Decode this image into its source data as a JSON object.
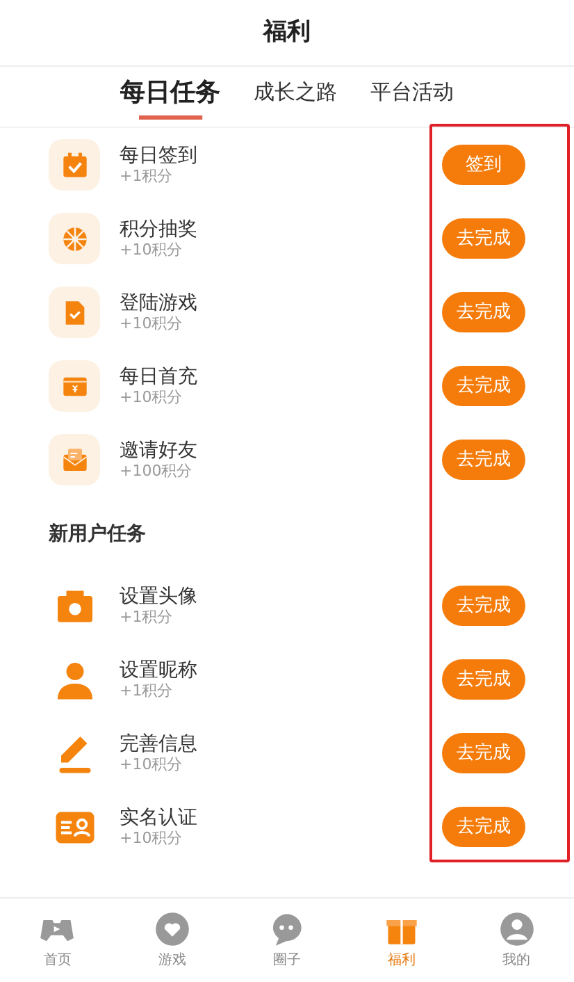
{
  "header": {
    "title": "福利"
  },
  "tabs": [
    {
      "label": "每日任务",
      "selected": true
    },
    {
      "label": "成长之路",
      "selected": false
    },
    {
      "label": "平台活动",
      "selected": false
    }
  ],
  "sections": [
    {
      "tasks": [
        {
          "kind": "calendar",
          "title": "每日签到",
          "reward": "+1积分",
          "action": "签到"
        },
        {
          "kind": "wheel",
          "title": "积分抽奖",
          "reward": "+10积分",
          "action": "去完成"
        },
        {
          "kind": "document",
          "title": "登陆游戏",
          "reward": "+10积分",
          "action": "去完成"
        },
        {
          "kind": "wallet",
          "title": "每日首充",
          "reward": "+10积分",
          "action": "去完成"
        },
        {
          "kind": "mail",
          "title": "邀请好友",
          "reward": "+100积分",
          "action": "去完成"
        }
      ]
    },
    {
      "heading": "新用户任务",
      "tasks": [
        {
          "kind": "camera",
          "title": "设置头像",
          "reward": "+1积分",
          "action": "去完成"
        },
        {
          "kind": "person",
          "title": "设置昵称",
          "reward": "+1积分",
          "action": "去完成"
        },
        {
          "kind": "pencil",
          "title": "完善信息",
          "reward": "+10积分",
          "action": "去完成"
        },
        {
          "kind": "idcard",
          "title": "实名认证",
          "reward": "+10积分",
          "action": "去完成"
        }
      ]
    }
  ],
  "bottom_nav": [
    {
      "kind": "gamepad",
      "label": "首页",
      "selected": false
    },
    {
      "kind": "heart",
      "label": "游戏",
      "selected": false
    },
    {
      "kind": "chat",
      "label": "圈子",
      "selected": false
    },
    {
      "kind": "gift",
      "label": "福利",
      "selected": true
    },
    {
      "kind": "user",
      "label": "我的",
      "selected": false
    }
  ]
}
